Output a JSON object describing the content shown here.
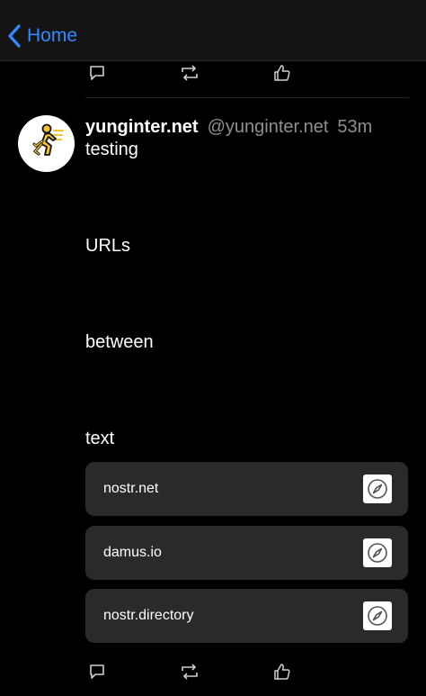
{
  "nav": {
    "back_label": "Home"
  },
  "post": {
    "display_name": "yunginter.net",
    "handle": "@yunginter.net",
    "timestamp": "53m",
    "lines": [
      "testing",
      "URLs",
      "between",
      "text"
    ],
    "links": [
      "nostr.net",
      "damus.io",
      "nostr.directory"
    ]
  },
  "icons": {
    "back": "chevron-left-icon",
    "reply": "speech-bubble-icon",
    "repost": "repost-arrows-icon",
    "like": "thumbs-up-icon",
    "link": "safari-compass-icon"
  },
  "colors": {
    "accent": "#2f8bff",
    "background": "#000000",
    "card": "#2a2a2c",
    "secondary_text": "#8e8e93"
  }
}
